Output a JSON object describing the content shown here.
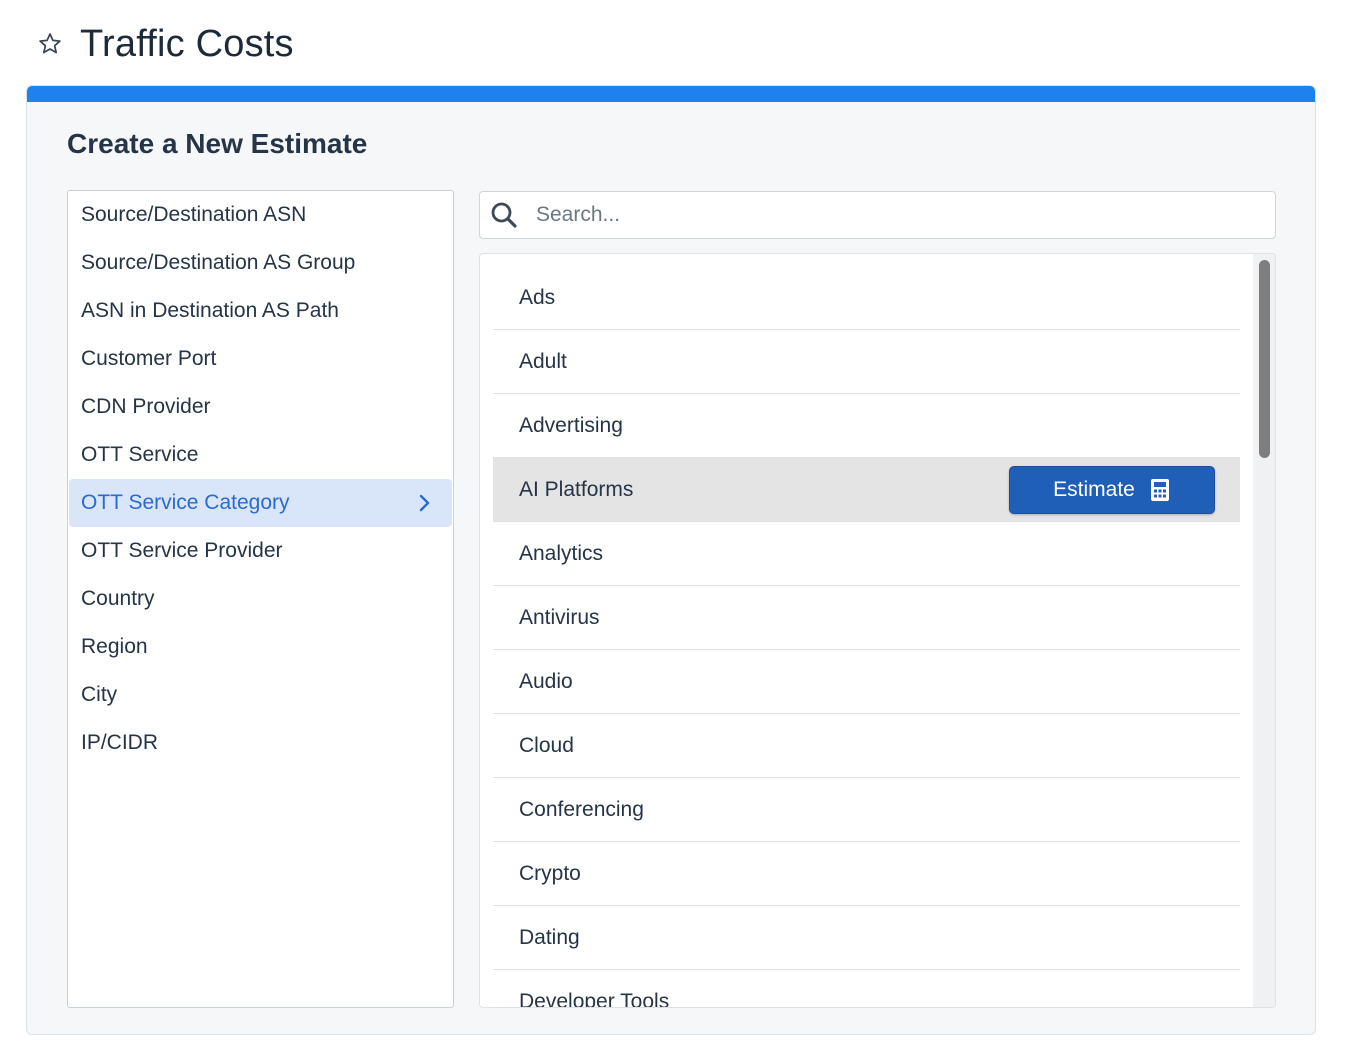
{
  "header": {
    "title": "Traffic Costs",
    "favorite_icon": "star-outline-icon"
  },
  "card": {
    "title": "Create a New Estimate",
    "accent_color": "#1e82ee"
  },
  "dimensions": {
    "items": [
      {
        "label": "Source/Destination ASN"
      },
      {
        "label": "Source/Destination AS Group"
      },
      {
        "label": "ASN in Destination AS Path"
      },
      {
        "label": "Customer Port"
      },
      {
        "label": "CDN Provider"
      },
      {
        "label": "OTT Service"
      },
      {
        "label": "OTT Service Category",
        "selected": true
      },
      {
        "label": "OTT Service Provider"
      },
      {
        "label": "Country"
      },
      {
        "label": "Region"
      },
      {
        "label": "City"
      },
      {
        "label": "IP/CIDR"
      }
    ]
  },
  "search": {
    "placeholder": "Search...",
    "value": ""
  },
  "options": {
    "items": [
      {
        "label": "Ads"
      },
      {
        "label": "Adult"
      },
      {
        "label": "Advertising"
      },
      {
        "label": "AI Platforms",
        "hovered": true
      },
      {
        "label": "Analytics"
      },
      {
        "label": "Antivirus"
      },
      {
        "label": "Audio"
      },
      {
        "label": "Cloud"
      },
      {
        "label": "Conferencing"
      },
      {
        "label": "Crypto"
      },
      {
        "label": "Dating"
      },
      {
        "label": "Developer Tools"
      }
    ],
    "estimate_label": "Estimate",
    "estimate_icon": "calculator-icon",
    "estimate_color": "#1f5fb8"
  }
}
